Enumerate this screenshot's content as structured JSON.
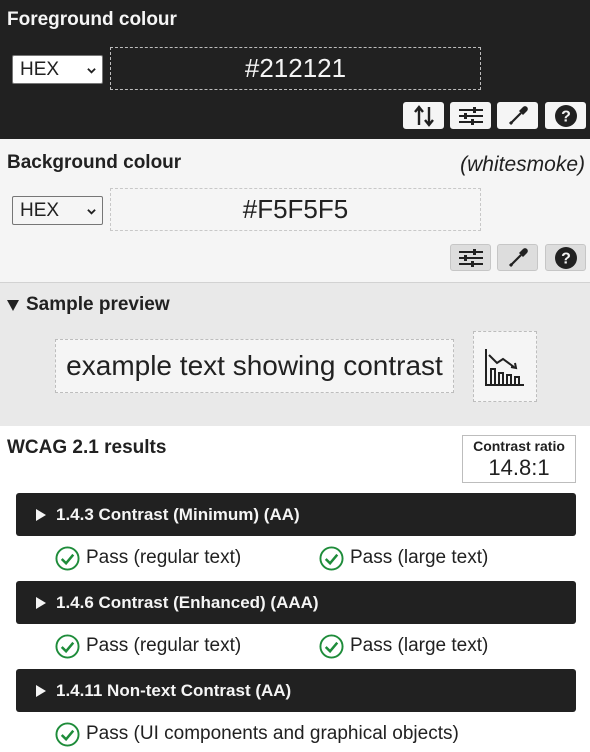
{
  "foreground": {
    "heading": "Foreground colour",
    "format": "HEX",
    "hex": "#212121",
    "tools": [
      "swap-icon",
      "sliders-icon",
      "eyedropper-icon",
      "help-icon"
    ]
  },
  "background": {
    "heading": "Background colour",
    "named": "(whitesmoke)",
    "format": "HEX",
    "hex": "#F5F5F5",
    "tools": [
      "sliders-icon",
      "eyedropper-icon",
      "help-icon"
    ]
  },
  "preview": {
    "summary": "Sample preview",
    "text": "example text showing contrast",
    "chart_icon": "chart-icon"
  },
  "results": {
    "title": "WCAG 2.1 results",
    "ratio_label": "Contrast ratio",
    "ratio_value": "14.8:1",
    "criteria": [
      {
        "label": "1.4.3 Contrast (Minimum) (AA)",
        "passes": [
          "Pass (regular text)",
          "Pass (large text)"
        ]
      },
      {
        "label": "1.4.6 Contrast (Enhanced) (AAA)",
        "passes": [
          "Pass (regular text)",
          "Pass (large text)"
        ]
      },
      {
        "label": "1.4.11 Non-text Contrast (AA)",
        "passes": [
          "Pass (UI components and graphical objects)"
        ]
      }
    ]
  },
  "colors": {
    "dark": "#212121",
    "light": "#F5F5F5",
    "pass": "#1e8c3a"
  }
}
